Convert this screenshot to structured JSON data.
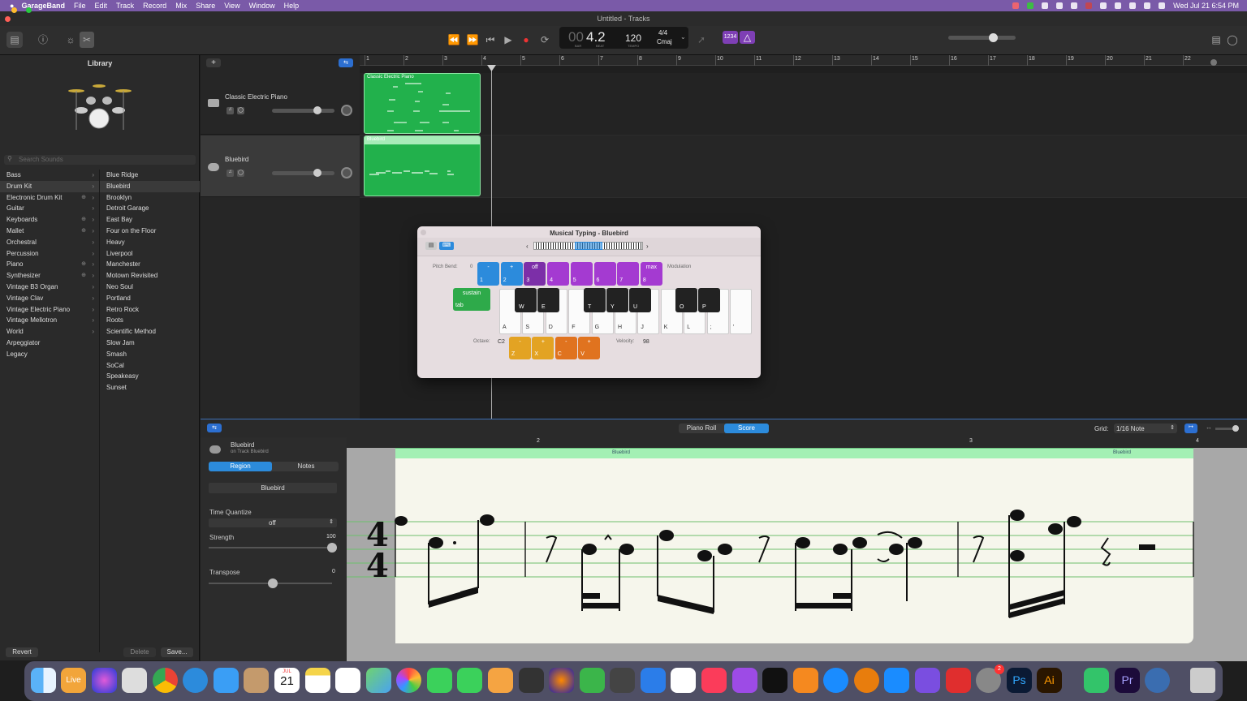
{
  "menubar": {
    "apple": "",
    "app": "GarageBand",
    "items": [
      "File",
      "Edit",
      "Track",
      "Record",
      "Mix",
      "Share",
      "View",
      "Window",
      "Help"
    ],
    "datetime": "Wed Jul 21  6:54 PM"
  },
  "window": {
    "title": "Untitled - Tracks"
  },
  "lcd": {
    "bar": "00",
    "beat": "4.2",
    "bar_label": "BAR",
    "beat_label": "BEAT",
    "tempo": "120",
    "tempo_label": "TEMPO",
    "timesig": "4/4",
    "key": "Cmaj"
  },
  "toolbar": {
    "count_in": "1234"
  },
  "library": {
    "title": "Library",
    "search_placeholder": "Search Sounds",
    "categories": [
      "Bass",
      "Drum Kit",
      "Electronic Drum Kit",
      "Guitar",
      "Keyboards",
      "Mallet",
      "Orchestral",
      "Percussion",
      "Piano",
      "Synthesizer",
      "Vintage B3 Organ",
      "Vintage Clav",
      "Vintage Electric Piano",
      "Vintage Mellotron",
      "World",
      "Arpeggiator",
      "Legacy"
    ],
    "kits": [
      "Blue Ridge",
      "Bluebird",
      "Brooklyn",
      "Detroit Garage",
      "East Bay",
      "Four on the Floor",
      "Heavy",
      "Liverpool",
      "Manchester",
      "Motown Revisited",
      "Neo Soul",
      "Portland",
      "Retro Rock",
      "Roots",
      "Scientific Method",
      "Slow Jam",
      "Smash",
      "SoCal",
      "Speakeasy",
      "Sunset"
    ],
    "revert": "Revert",
    "delete": "Delete",
    "save": "Save..."
  },
  "tracks": [
    {
      "name": "Classic Electric Piano"
    },
    {
      "name": "Bluebird"
    }
  ],
  "ruler": [
    "1",
    "2",
    "3",
    "4",
    "5",
    "6",
    "7",
    "8",
    "9",
    "10",
    "11",
    "12",
    "13",
    "14",
    "15",
    "16",
    "17",
    "18",
    "19",
    "20",
    "21",
    "22"
  ],
  "regions": [
    {
      "name": "Classic Electric Piano"
    },
    {
      "name": "Bluebird"
    }
  ],
  "musical_typing": {
    "title": "Musical Typing - Bluebird",
    "pitch_bend": "Pitch Bend:",
    "pitch_value": "0",
    "modulation": "Modulation",
    "sustain": "sustain",
    "tab": "tab",
    "octave": "Octave:",
    "octave_value": "C2",
    "velocity": "Velocity:",
    "velocity_value": "98",
    "num_keys": [
      {
        "top": "-",
        "l": "1"
      },
      {
        "top": "+",
        "l": "2"
      },
      {
        "top": "off",
        "l": "3"
      },
      {
        "top": "",
        "l": "4"
      },
      {
        "top": "",
        "l": "5"
      },
      {
        "top": "",
        "l": "6"
      },
      {
        "top": "",
        "l": "7"
      },
      {
        "top": "max",
        "l": "8"
      }
    ],
    "white": [
      "A",
      "S",
      "D",
      "F",
      "G",
      "H",
      "J",
      "K",
      "L",
      ";",
      "'"
    ],
    "black": [
      "W",
      "E",
      "T",
      "Y",
      "U",
      "O",
      "P"
    ],
    "oct_keys": [
      {
        "top": "-",
        "l": "Z"
      },
      {
        "top": "+",
        "l": "X"
      },
      {
        "top": "-",
        "l": "C"
      },
      {
        "top": "+",
        "l": "V"
      }
    ]
  },
  "editor": {
    "piano_roll": "Piano Roll",
    "score": "Score",
    "grid_label": "Grid:",
    "grid_value": "1/16 Note",
    "track": "Bluebird",
    "track_sub": "on Track Bluebird",
    "region_tab": "Region",
    "notes_tab": "Notes",
    "region_name": "Bluebird",
    "time_quantize": "Time Quantize",
    "tq_value": "off",
    "strength": "Strength",
    "strength_value": "100",
    "transpose": "Transpose",
    "transpose_value": "0",
    "ruler": [
      "2",
      "3",
      "4"
    ],
    "region_labels": [
      "Bluebird",
      "Bluebird"
    ],
    "strength_level": 1.0,
    "transpose_level": 0.5
  },
  "dock": {
    "calendar_month": "JUL",
    "calendar_day": "21",
    "badge": "2"
  }
}
